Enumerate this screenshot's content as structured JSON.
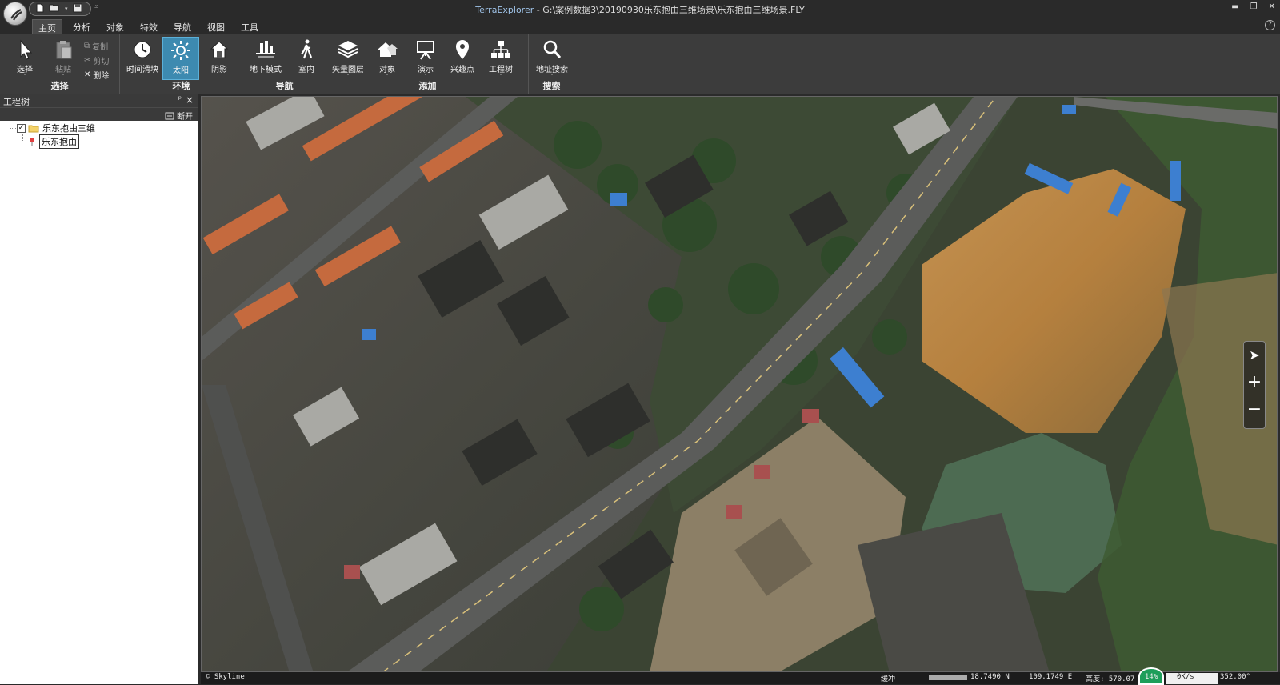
{
  "titlebar": {
    "app_name": "TerraExplorer",
    "separator": " - ",
    "file_path": "G:\\案例数据3\\20190930乐东抱由三维场景\\乐东抱由三维场景.FLY"
  },
  "menu": {
    "tabs": [
      {
        "label": "主页",
        "active": true
      },
      {
        "label": "分析"
      },
      {
        "label": "对象"
      },
      {
        "label": "特效"
      },
      {
        "label": "导航"
      },
      {
        "label": "视图"
      },
      {
        "label": "工具"
      }
    ]
  },
  "ribbon": {
    "groups": {
      "select": {
        "label": "选择",
        "select_btn": "选择",
        "paste_btn": "粘贴",
        "copy_btn": "复制",
        "cut_btn": "剪切",
        "delete_btn": "删除"
      },
      "environment": {
        "label": "环境",
        "time_slider_btn": "时间滑块",
        "sun_btn": "太阳",
        "shadow_btn": "阴影"
      },
      "navigation": {
        "label": "导航",
        "underground_btn": "地下模式",
        "indoor_btn": "室内"
      },
      "add": {
        "label": "添加",
        "vector_layer_btn": "矢量图层",
        "object_btn": "对象",
        "presentation_btn": "演示",
        "poi_btn": "兴趣点",
        "project_tree_btn": "工程树"
      },
      "search": {
        "label": "搜索",
        "address_search_btn": "地址搜索"
      }
    }
  },
  "tree_panel": {
    "title": "工程树",
    "disconnect_label": "断开",
    "items": [
      {
        "label": "乐东抱由三维",
        "checked": true,
        "type": "folder"
      },
      {
        "label": "乐东抱由",
        "type": "location"
      }
    ]
  },
  "status": {
    "copyright": "© Skyline",
    "buffer_label": "缓冲",
    "lat": "18.7490 N",
    "lon": "109.1749 E",
    "altitude": "高度: 570.07",
    "percent": "14%",
    "speed": "0K/s",
    "heading": "352.00°"
  }
}
